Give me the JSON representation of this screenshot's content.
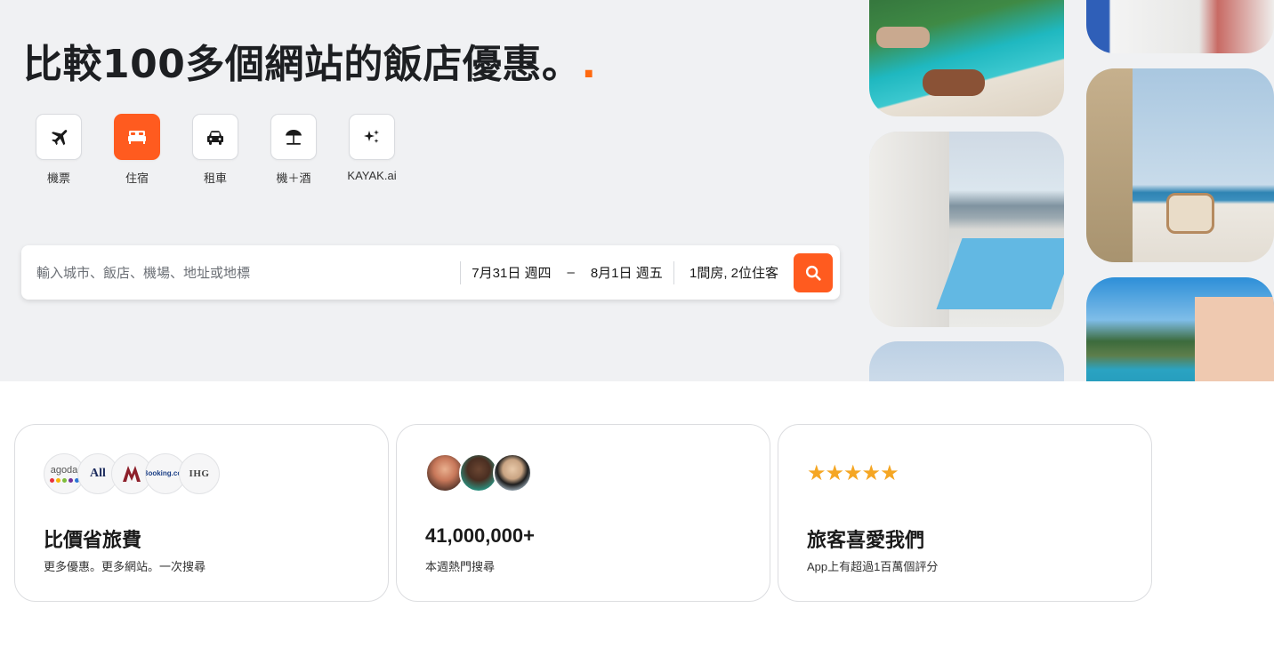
{
  "hero": {
    "headline": "比較100多個網站的飯店優惠。",
    "headline_dot": "."
  },
  "verticals": [
    {
      "label": "機票",
      "icon": "plane-icon",
      "active": false
    },
    {
      "label": "住宿",
      "icon": "bed-icon",
      "active": true
    },
    {
      "label": "租車",
      "icon": "car-icon",
      "active": false
    },
    {
      "label": "機＋酒",
      "icon": "beach-umbrella-icon",
      "active": false
    },
    {
      "label": "KAYAK.ai",
      "icon": "sparkle-icon",
      "active": false
    }
  ],
  "search": {
    "destination_placeholder": "輸入城市、飯店、機場、地址或地標",
    "checkin": "7月31日 週四",
    "date_separator": "–",
    "checkout": "8月1日 週五",
    "guests": "1間房, 2位住客"
  },
  "cards": [
    {
      "title": "比價省旅費",
      "subtitle": "更多優惠。更多網站。一次搜尋",
      "logos": [
        "agoda",
        "All",
        "MARRIOTT",
        "Booking.com",
        "IHG"
      ]
    },
    {
      "title": "41,000,000+",
      "subtitle": "本週熱門搜尋"
    },
    {
      "title": "旅客喜愛我們",
      "subtitle": "App上有超過1百萬個評分",
      "stars": "★★★★★"
    }
  ],
  "colors": {
    "accent": "#ff5b1f",
    "hero_bg": "#f0f1f3",
    "star": "#f5a623"
  }
}
